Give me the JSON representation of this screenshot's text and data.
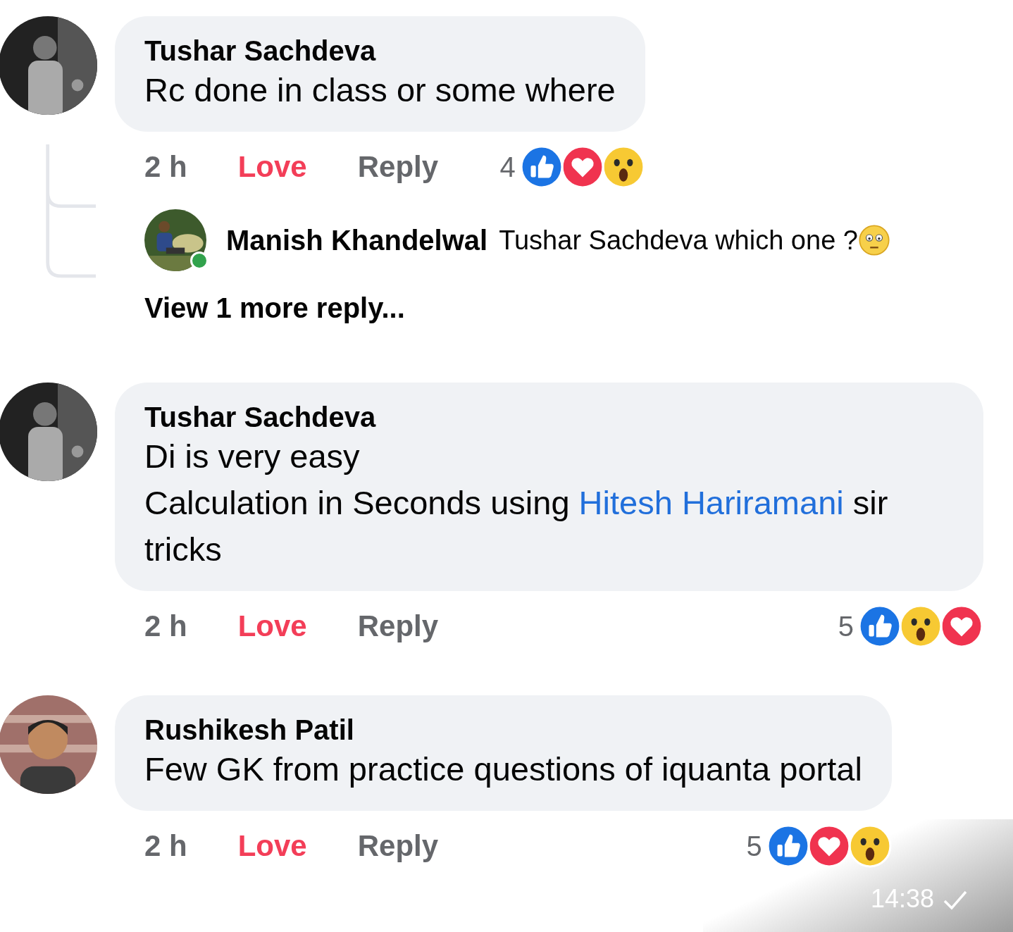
{
  "comments": [
    {
      "author": "Tushar Sachdeva",
      "body": [
        {
          "text": "Rc done in class or some where"
        }
      ],
      "time": "2 h",
      "react": {
        "label": "Love",
        "selected": true
      },
      "reply": "Reply",
      "reaction_count": "4",
      "reactions": [
        {
          "kind": "like"
        },
        {
          "kind": "love"
        },
        {
          "kind": "wow"
        }
      ],
      "replies": [
        {
          "author": "Manish Khandelwal",
          "online": true,
          "text": "Tushar Sachdeva which one ?",
          "emoji": {
            "kind": "confused"
          }
        }
      ],
      "more_replies": "View 1 more reply..."
    },
    {
      "author": "Tushar Sachdeva",
      "body": [
        {
          "text": "Di is very easy\nCalculation in Seconds using "
        },
        {
          "text": "Hitesh Hariramani",
          "kind": "mention"
        },
        {
          "text": " sir tricks"
        }
      ],
      "time": "2 h",
      "react": {
        "label": "Love",
        "selected": true
      },
      "reply": "Reply",
      "reaction_count": "5",
      "reactions": [
        {
          "kind": "like"
        },
        {
          "kind": "wow"
        },
        {
          "kind": "love"
        }
      ]
    },
    {
      "author": "Rushikesh Patil",
      "body": [
        {
          "text": "Few GK from practice questions of iquanta portal"
        }
      ],
      "time": "2 h",
      "react": {
        "label": "Love",
        "selected": true
      },
      "reply": "Reply",
      "reaction_count": "5",
      "reactions": [
        {
          "kind": "like"
        },
        {
          "kind": "love"
        },
        {
          "kind": "wow"
        }
      ]
    }
  ],
  "overlay": {
    "time": "14:38",
    "sent": true
  }
}
